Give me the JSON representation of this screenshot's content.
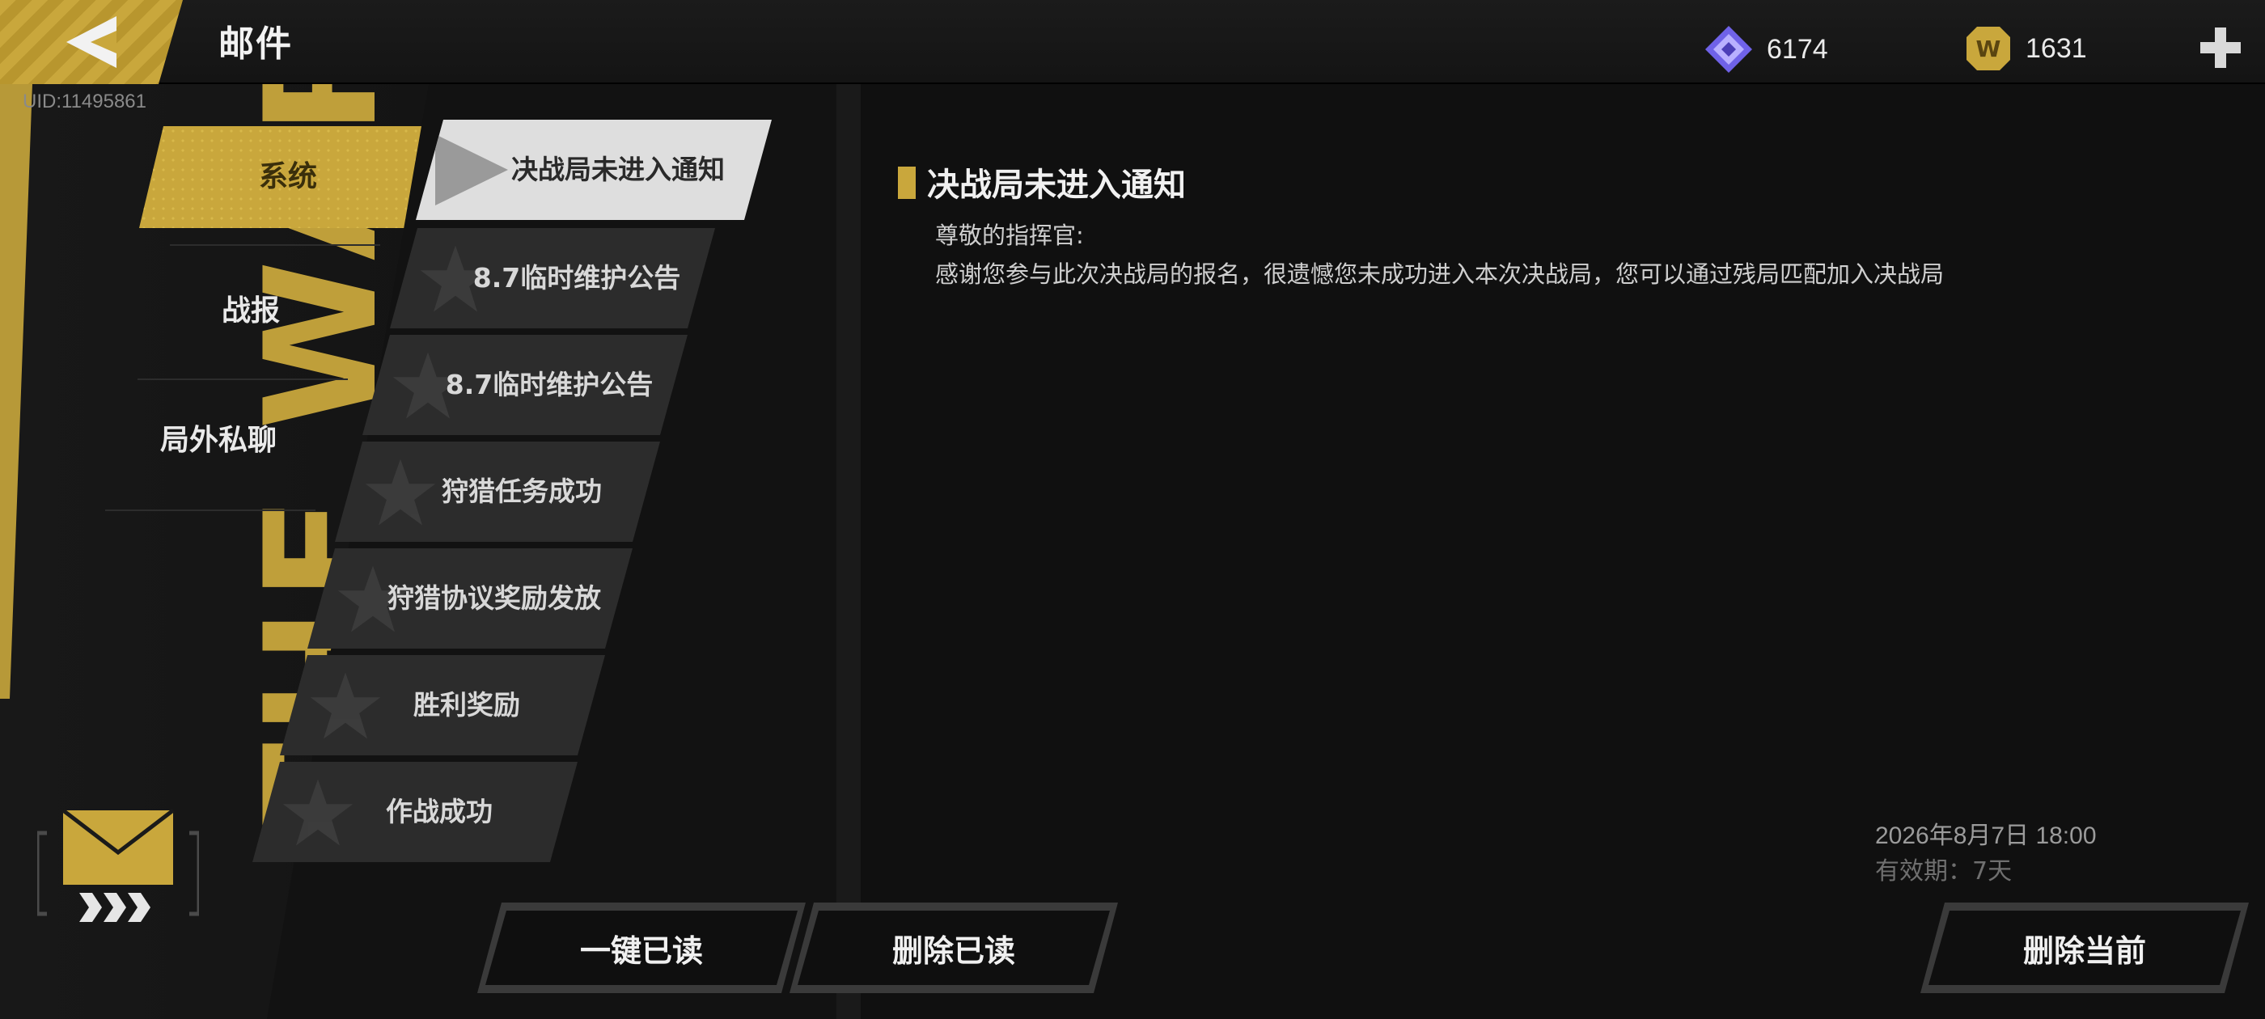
{
  "header": {
    "title": "邮件",
    "uid": "UID:11495861",
    "currencies": [
      {
        "icon": "gem-icon",
        "value": "6174",
        "color": "#7b6cff"
      },
      {
        "icon": "coin-icon",
        "value": "1631",
        "color": "#c9a73c"
      }
    ]
  },
  "colors": {
    "accent": "#c9a73c",
    "panel": "#101010"
  },
  "sidebar": {
    "categories": [
      {
        "label": "系统",
        "active": true
      },
      {
        "label": "战报",
        "active": false
      },
      {
        "label": "局外私聊",
        "active": false
      }
    ],
    "decor_text": "THE WAR"
  },
  "mail_list": [
    {
      "label": "决战局未进入通知",
      "active": true
    },
    {
      "label": "8.7临时维护公告",
      "active": false
    },
    {
      "label": "8.7临时维护公告",
      "active": false
    },
    {
      "label": "狩猎任务成功",
      "active": false
    },
    {
      "label": "狩猎协议奖励发放",
      "active": false
    },
    {
      "label": "胜利奖励",
      "active": false
    },
    {
      "label": "作战成功",
      "active": false
    }
  ],
  "detail": {
    "title": "决战局未进入通知",
    "greeting": "尊敬的指挥官:",
    "body": "感谢您参与此次决战局的报名，很遗憾您未成功进入本次决战局，您可以通过残局匹配加入决战局",
    "date": "2026年8月7日 18:00",
    "validity": "有效期：7天"
  },
  "actions": {
    "read_all": "一键已读",
    "delete_read": "删除已读",
    "delete_current": "删除当前"
  }
}
